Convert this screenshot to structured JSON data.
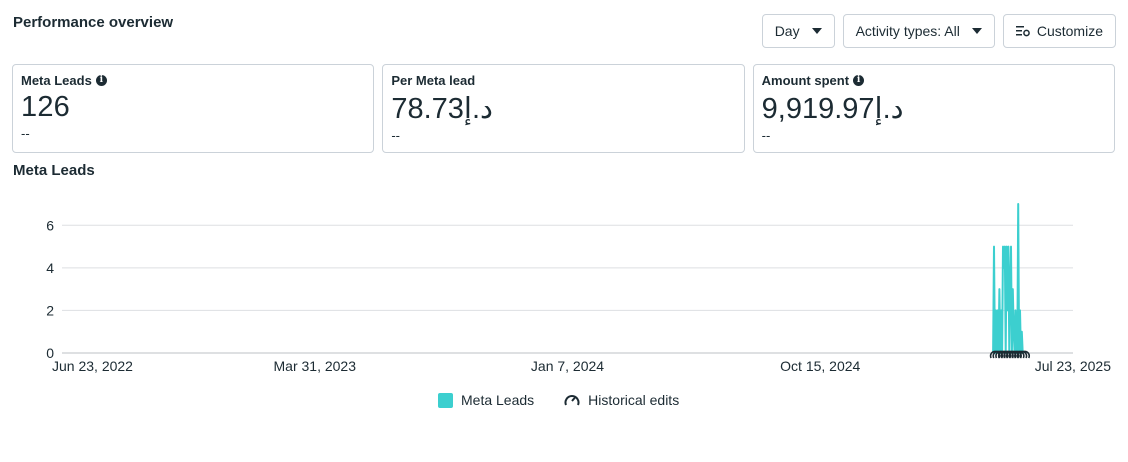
{
  "header": {
    "title": "Performance overview",
    "day_label": "Day",
    "activity_label": "Activity types: All",
    "customize_label": "Customize"
  },
  "cards": [
    {
      "label": "Meta Leads",
      "has_info": true,
      "value": "126",
      "sub": "--"
    },
    {
      "label": "Per Meta lead",
      "has_info": false,
      "value": "78.73د.إ",
      "sub": "--"
    },
    {
      "label": "Amount spent",
      "has_info": true,
      "value": "9,919.97د.إ",
      "sub": "--"
    }
  ],
  "chart_title": "Meta Leads",
  "legend": {
    "series_label": "Meta Leads",
    "edits_label": "Historical edits",
    "series_icon": "teal-square-icon",
    "edits_icon": "gauge-icon"
  },
  "colors": {
    "series": "#3ccfcf",
    "grid": "#dddfe2",
    "text": "#1c2b33"
  },
  "chart_data": {
    "type": "line",
    "series": [
      {
        "name": "Meta Leads",
        "x_start": "2025-04-25",
        "values": [
          0,
          5,
          0,
          2,
          0,
          2,
          0,
          3,
          0,
          2,
          0,
          5,
          4,
          5,
          0,
          5,
          2,
          5,
          0,
          3,
          5,
          0,
          3,
          1,
          0,
          2,
          0,
          0,
          7,
          0,
          2,
          0,
          1,
          0,
          0
        ]
      }
    ],
    "xlabel": "",
    "ylabel": "",
    "ylim": [
      0,
      7
    ],
    "y_ticks": [
      0,
      2,
      4,
      6
    ],
    "x_tick_labels": [
      "Jun 23, 2022",
      "Mar 31, 2023",
      "Jan 7, 2024",
      "Oct 15, 2024",
      "Jul 23, 2025"
    ],
    "x_range": [
      "2022-06-23",
      "2025-07-23"
    ],
    "grid": true
  }
}
